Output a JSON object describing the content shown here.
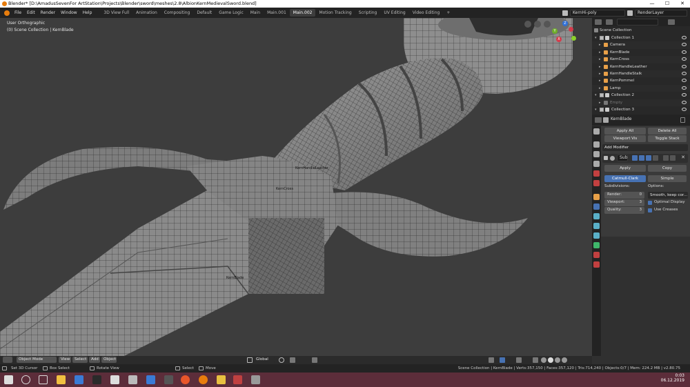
{
  "window": {
    "title": "Blender* [D:\\AmadusSevenFor ArtStation\\Projects\\Blender\\sword\\meshes\\2.8\\AlbionKernMedievalSword.blend]",
    "minimize": "—",
    "maximize": "☐",
    "close": "✕"
  },
  "menu": [
    "File",
    "Edit",
    "Render",
    "Window",
    "Help"
  ],
  "workspaces": [
    "3D View Full",
    "Animation",
    "Compositing",
    "Default",
    "Game Logic",
    "Main",
    "Main.001",
    "Main.002",
    "Motion Tracking",
    "Scripting",
    "UV Editing",
    "Video Editing"
  ],
  "active_workspace": "Main.002",
  "add_workspace": "+",
  "scene_name": "KernHi-poly",
  "view_layer": "RenderLayer",
  "viewport": {
    "view_label": "User Orthographic",
    "collection_label": "(0) Scene Collection | KernBlade",
    "object_labels": [
      "KernHandleLeather",
      "KernCross",
      "KernBlade"
    ],
    "gizmo": {
      "x": "X",
      "y": "Y",
      "z": "Z"
    }
  },
  "viewport_header": {
    "mode": "Object Mode",
    "menus": [
      "View",
      "Select",
      "Add",
      "Object"
    ],
    "transform": "Global"
  },
  "outliner": {
    "root": "Scene Collection",
    "rows": [
      {
        "name": "Collection 1",
        "kind": "collection",
        "indent": 1,
        "color": "#cccccc"
      },
      {
        "name": "Camera",
        "kind": "camera",
        "indent": 2,
        "color": "#e8a048"
      },
      {
        "name": "KernBlade",
        "kind": "mesh",
        "indent": 2,
        "color": "#e8a048"
      },
      {
        "name": "KernCross",
        "kind": "mesh",
        "indent": 2,
        "color": "#e8a048"
      },
      {
        "name": "KernHandleLeather",
        "kind": "mesh",
        "indent": 2,
        "color": "#e8a048"
      },
      {
        "name": "KernHandleStalk",
        "kind": "mesh",
        "indent": 2,
        "color": "#e8a048"
      },
      {
        "name": "KernPommel",
        "kind": "mesh",
        "indent": 2,
        "color": "#e8a048"
      },
      {
        "name": "Lamp",
        "kind": "light",
        "indent": 2,
        "color": "#e8a048"
      },
      {
        "name": "Collection 2",
        "kind": "collection",
        "indent": 1,
        "color": "#cccccc"
      },
      {
        "name": "Empty",
        "kind": "empty",
        "indent": 2,
        "color": "#777777"
      },
      {
        "name": "Collection 3",
        "kind": "collection",
        "indent": 1,
        "color": "#cccccc"
      }
    ]
  },
  "properties": {
    "object_name": "KernBlade",
    "apply_all": "Apply All",
    "delete_all": "Delete All",
    "viewport_vis": "Viewport Vis",
    "toggle_stack": "Toggle Stack",
    "add_modifier": "Add Modifier",
    "modifier_name": "Sub",
    "apply": "Apply",
    "copy": "Copy",
    "catmull": "Catmull-Clark",
    "simple": "Simple",
    "subdivisions": "Subdivisions:",
    "options": "Options:",
    "render_label": "Render:",
    "render_val": "0",
    "viewport_label": "Viewport:",
    "viewport_val": "3",
    "quality_label": "Quality:",
    "quality_val": "3",
    "uv_smooth": "Smooth, keep cor...",
    "optimal_display": "Optimal Display",
    "use_creases": "Use Creases"
  },
  "status": {
    "left": [
      "Set 3D Cursor",
      "Box Select",
      "Rotate View",
      "Select",
      "Move"
    ],
    "right": "Scene Collection | KernBlade | Verts:357,150 | Faces:357,120 | Tris:714,240 | Objects:0/7 | Mem: 224.2 MB | v2.80.75"
  },
  "taskbar": {
    "time": "0:03",
    "date": "06.12.2019"
  },
  "colors": {
    "accent": "#4772b3",
    "active_tab": "#3d3d3d",
    "taskbar": "#5c2d3a"
  }
}
